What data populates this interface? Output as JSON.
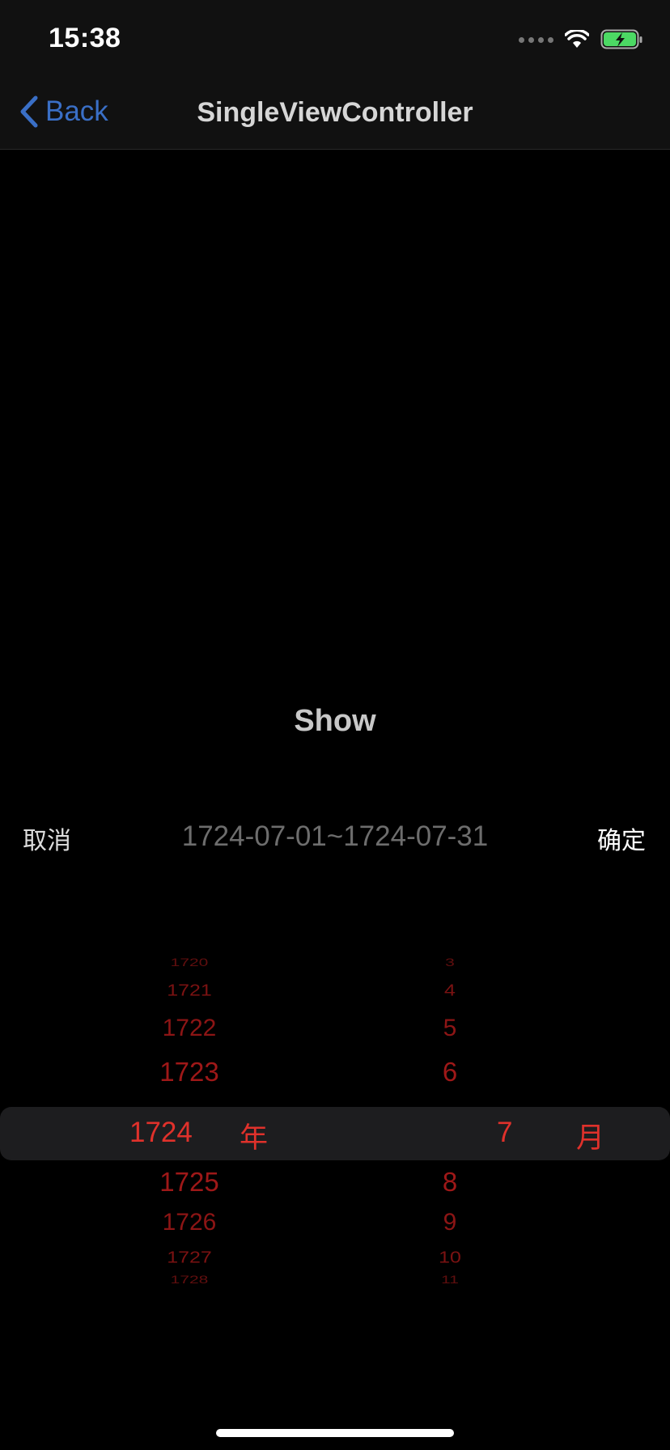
{
  "status_bar": {
    "time": "15:38"
  },
  "nav": {
    "back_label": "Back",
    "title": "SingleViewController"
  },
  "main": {
    "show_label": "Show"
  },
  "picker_toolbar": {
    "cancel_label": "取消",
    "range_text": "1724-07-01~1724-07-31",
    "confirm_label": "确定"
  },
  "picker": {
    "year_items": [
      "1720",
      "1721",
      "1722",
      "1723",
      "1725",
      "1726",
      "1727",
      "1728"
    ],
    "month_items": [
      "3",
      "4",
      "5",
      "6",
      "8",
      "9",
      "10",
      "11"
    ],
    "selected_year": "1724",
    "year_unit": "年",
    "selected_month": "7",
    "month_unit": "月"
  },
  "colors": {
    "picker_accent": "#e0312b",
    "back_blue": "#3a6fc6",
    "battery_green": "#4cd964"
  }
}
